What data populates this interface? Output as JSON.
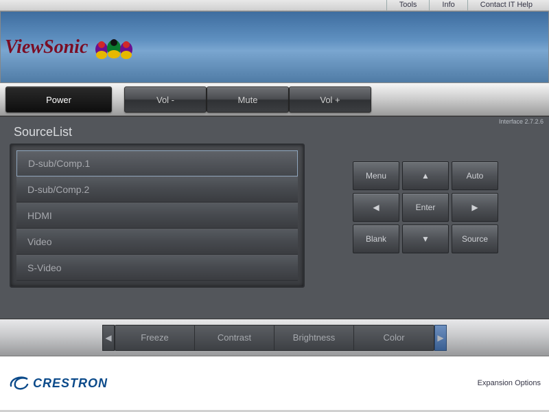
{
  "topbar": {
    "tools": "Tools",
    "info": "Info",
    "contact": "Contact IT Help"
  },
  "brand": {
    "name": "ViewSonic"
  },
  "toolbar": {
    "power": "Power",
    "vol_down": "Vol -",
    "mute": "Mute",
    "vol_up": "Vol +"
  },
  "interface_version": "Interface 2.7.2.6",
  "source_list": {
    "title": "SourceList",
    "items": [
      "D-sub/Comp.1",
      "D-sub/Comp.2",
      "HDMI",
      "Video",
      "S-Video"
    ]
  },
  "navpad": {
    "menu": "Menu",
    "auto": "Auto",
    "enter": "Enter",
    "blank": "Blank",
    "source": "Source"
  },
  "carousel": {
    "items": [
      "Freeze",
      "Contrast",
      "Brightness",
      "Color"
    ]
  },
  "footer": {
    "vendor": "CRESTRON",
    "expansion": "Expansion Options"
  }
}
